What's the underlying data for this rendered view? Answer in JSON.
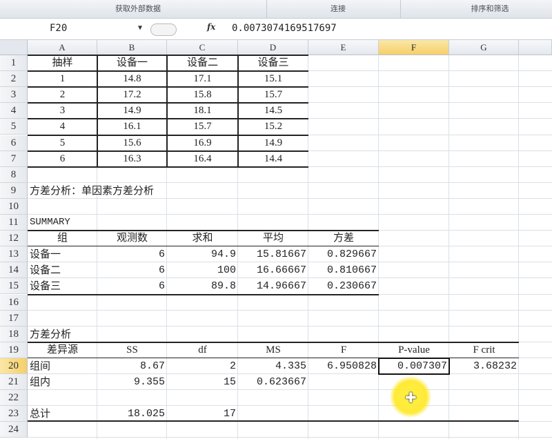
{
  "ribbon": {
    "groups": [
      "获取外部数据",
      "连接",
      "排序和筛选"
    ]
  },
  "formula_bar": {
    "name_box": "F20",
    "fx_label": "fx",
    "formula": "0.0073074169517697"
  },
  "columns": [
    "A",
    "B",
    "C",
    "D",
    "E",
    "F",
    "G"
  ],
  "rows": [
    "1",
    "2",
    "3",
    "4",
    "5",
    "6",
    "7",
    "8",
    "9",
    "10",
    "11",
    "12",
    "13",
    "14",
    "15",
    "16",
    "17",
    "18",
    "19",
    "20",
    "21",
    "22",
    "23",
    "24"
  ],
  "active_cell": {
    "col": "F",
    "row": "20"
  },
  "sample_table": {
    "header": [
      "抽样",
      "设备一",
      "设备二",
      "设备三"
    ],
    "rows": [
      [
        "1",
        "14.8",
        "17.1",
        "15.1"
      ],
      [
        "2",
        "17.2",
        "15.8",
        "15.7"
      ],
      [
        "3",
        "14.9",
        "18.1",
        "14.5"
      ],
      [
        "4",
        "16.1",
        "15.7",
        "15.2"
      ],
      [
        "5",
        "15.6",
        "16.9",
        "14.9"
      ],
      [
        "6",
        "16.3",
        "16.4",
        "14.4"
      ]
    ]
  },
  "anova_title": "方差分析：单因素方差分析",
  "summary": {
    "label": "SUMMARY",
    "header": [
      "组",
      "观测数",
      "求和",
      "平均",
      "方差"
    ],
    "rows": [
      [
        "设备一",
        "6",
        "94.9",
        "15.81667",
        "0.829667"
      ],
      [
        "设备二",
        "6",
        "100",
        "16.66667",
        "0.810667"
      ],
      [
        "设备三",
        "6",
        "89.8",
        "14.96667",
        "0.230667"
      ]
    ]
  },
  "anova": {
    "label": "方差分析",
    "header": [
      "差异源",
      "SS",
      "df",
      "MS",
      "F",
      "P-value",
      "F crit"
    ],
    "rows": [
      [
        "组间",
        "8.67",
        "2",
        "4.335",
        "6.950828",
        "0.007307",
        "3.68232"
      ],
      [
        "组内",
        "9.355",
        "15",
        "0.623667",
        "",
        "",
        ""
      ]
    ],
    "total": [
      "总计",
      "18.025",
      "17"
    ]
  }
}
